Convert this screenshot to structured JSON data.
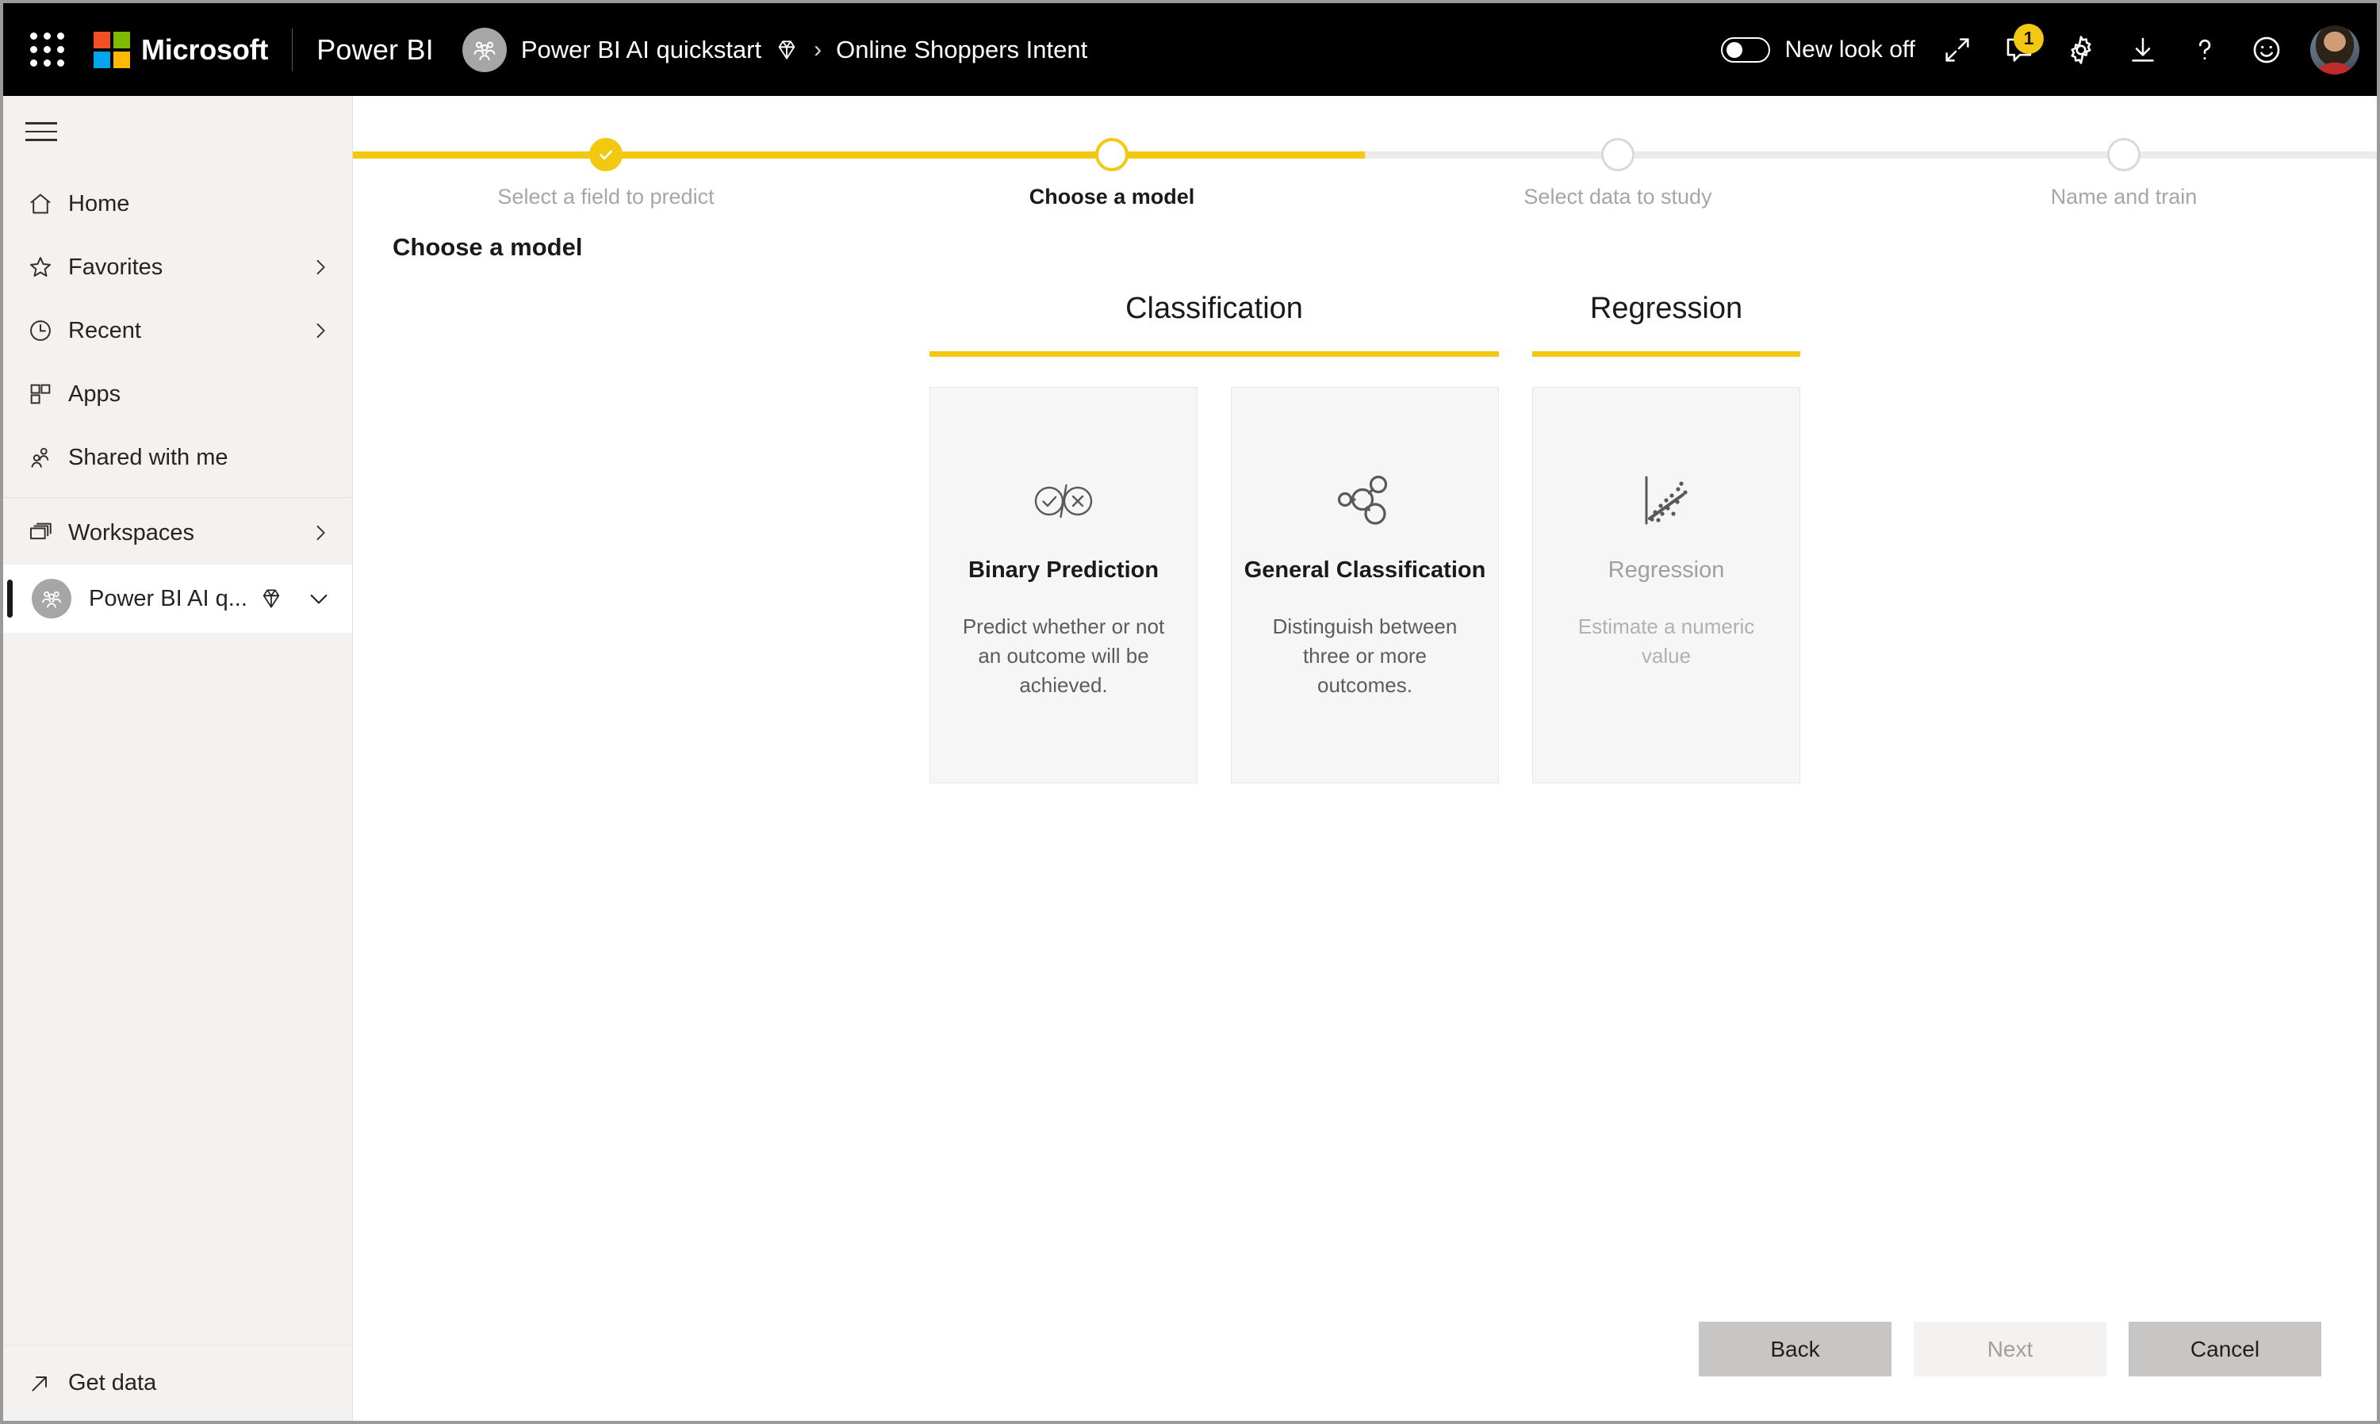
{
  "header": {
    "waffle_name": "app-launcher",
    "microsoft_label": "Microsoft",
    "product_label": "Power BI",
    "breadcrumb": {
      "workspace": "Power BI AI quickstart",
      "separator": "›",
      "current": "Online Shoppers Intent"
    },
    "toggle_label": "New look off",
    "toggle_state": "off",
    "notification_count": "1",
    "accent_yellow": "#F2C811",
    "bar_background": "#000000"
  },
  "sidebar": {
    "collapse_label": "hamburger-menu",
    "items": [
      {
        "label": "Home",
        "icon": "home-icon",
        "chevron": false
      },
      {
        "label": "Favorites",
        "icon": "star-icon",
        "chevron": true
      },
      {
        "label": "Recent",
        "icon": "clock-icon",
        "chevron": true
      },
      {
        "label": "Apps",
        "icon": "apps-icon",
        "chevron": false
      },
      {
        "label": "Shared with me",
        "icon": "people-icon",
        "chevron": false
      }
    ],
    "workspaces": {
      "label": "Workspaces",
      "icon": "workspaces-icon",
      "chevron": true
    },
    "active_workspace": {
      "label": "Power BI AI q...",
      "icon": "group-icon",
      "premium_icon": "diamond-icon",
      "chevron": "chevron-down-icon"
    },
    "bottom": {
      "label": "Get data",
      "icon": "arrow-up-right-icon"
    }
  },
  "main": {
    "page_title": "Choose a model",
    "steps": [
      {
        "label": "Select a field to predict",
        "state": "done"
      },
      {
        "label": "Choose a model",
        "state": "current"
      },
      {
        "label": "Select data to study",
        "state": "todo"
      },
      {
        "label": "Name and train",
        "state": "todo"
      }
    ],
    "groups": [
      {
        "title": "Classification",
        "cards": [
          {
            "title": "Binary Prediction",
            "desc": "Predict whether or not an outcome will be achieved.",
            "icon": "check-cross-circles-icon",
            "disabled": false
          },
          {
            "title": "General Classification",
            "desc": "Distinguish between three or more outcomes.",
            "icon": "clustered-bubbles-icon",
            "disabled": false
          }
        ]
      },
      {
        "title": "Regression",
        "cards": [
          {
            "title": "Regression",
            "desc": "Estimate a numeric value",
            "icon": "scatter-trendline-icon",
            "disabled": true
          }
        ]
      }
    ],
    "footer": {
      "back": "Back",
      "next": "Next",
      "cancel": "Cancel"
    }
  }
}
